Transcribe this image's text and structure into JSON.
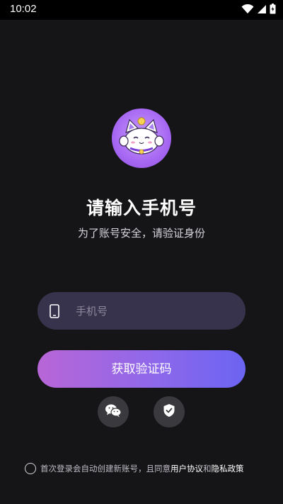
{
  "status_bar": {
    "time": "10:02"
  },
  "login": {
    "title": "请输入手机号",
    "subtitle": "为了账号安全，请验证身份",
    "phone_placeholder": "手机号",
    "phone_value": "",
    "get_code_label": "获取验证码"
  },
  "social": [
    {
      "icon": "wechat-icon"
    },
    {
      "icon": "shield-check-icon"
    }
  ],
  "agreement": {
    "prefix": "首次登录会自动创建新账号，且同意",
    "user_agreement": "用户协议",
    "and": "和",
    "privacy_policy": "隐私政策"
  },
  "colors": {
    "background": "#151417",
    "input_bg": "#38334c",
    "button_gradient_start": "#b866d6",
    "button_gradient_end": "#6b64f2",
    "logo_bg": "#a768f2"
  }
}
